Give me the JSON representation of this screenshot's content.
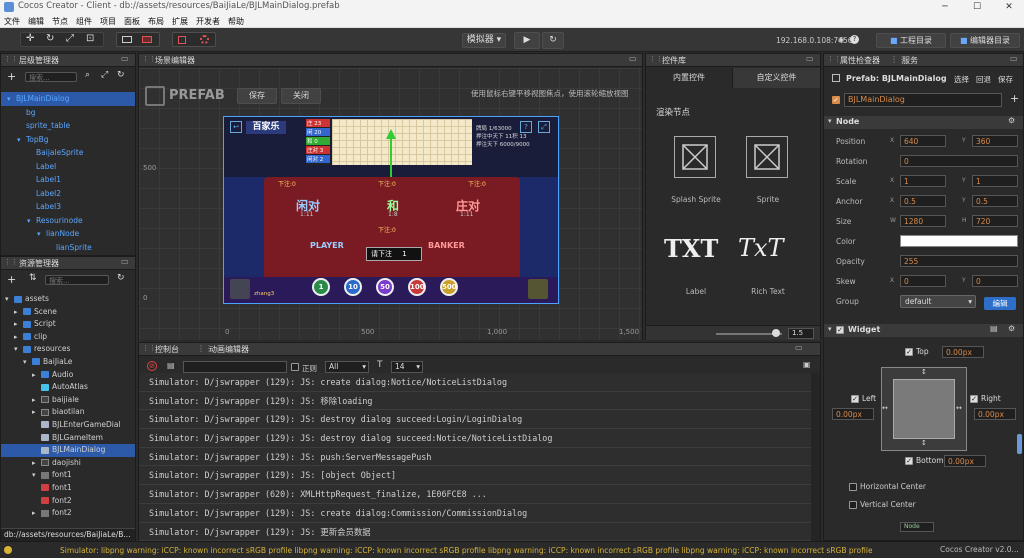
{
  "titlebar": {
    "title": "Cocos Creator - Client - db://assets/resources/BaiJiaLe/BJLMainDialog.prefab",
    "minimize": "─",
    "maximize": "☐",
    "close": "✕"
  },
  "menu": [
    "文件",
    "编辑",
    "节点",
    "组件",
    "项目",
    "面板",
    "布局",
    "扩展",
    "开发者",
    "帮助"
  ],
  "toolbar": {
    "simulator_label": "模拟器 ▾",
    "play_icon": "▶",
    "refresh_icon": "↻",
    "ip_text": "192.168.0.108:7456",
    "wifi_icon": "◉",
    "help_icon": "?",
    "project_btn": "工程目录",
    "editor_btn": "编辑器目录"
  },
  "hierarchy": {
    "title": "层级管理器",
    "search_placeholder": "搜索...",
    "nodes": [
      {
        "label": "BJLMainDialog",
        "color": "blue",
        "indent": 0,
        "arrow": "▾",
        "selected": true
      },
      {
        "label": "bg",
        "color": "blue",
        "indent": 1,
        "arrow": ""
      },
      {
        "label": "sprite_table",
        "color": "blue",
        "indent": 1,
        "arrow": ""
      },
      {
        "label": "TopBg",
        "color": "blue",
        "indent": 1,
        "arrow": "▾"
      },
      {
        "label": "BaijaleSprite",
        "color": "blue",
        "indent": 2,
        "arrow": ""
      },
      {
        "label": "Label",
        "color": "blue",
        "indent": 2,
        "arrow": ""
      },
      {
        "label": "Label1",
        "color": "blue",
        "indent": 2,
        "arrow": ""
      },
      {
        "label": "Label2",
        "color": "blue",
        "indent": 2,
        "arrow": ""
      },
      {
        "label": "Label3",
        "color": "blue",
        "indent": 2,
        "arrow": ""
      },
      {
        "label": "Resourinode",
        "color": "blue",
        "indent": 2,
        "arrow": "▾"
      },
      {
        "label": "lianNode",
        "color": "blue",
        "indent": 3,
        "arrow": "▾"
      },
      {
        "label": "lianSprite",
        "color": "blue",
        "indent": 4,
        "arrow": ""
      }
    ]
  },
  "assets": {
    "title": "资源管理器",
    "search_placeholder": "搜索...",
    "items": [
      {
        "label": "assets",
        "indent": 0,
        "arrow": "▾",
        "icon": "folder"
      },
      {
        "label": "Scene",
        "indent": 1,
        "arrow": "▸",
        "icon": "folder"
      },
      {
        "label": "Script",
        "indent": 1,
        "arrow": "▸",
        "icon": "folder"
      },
      {
        "label": "clip",
        "indent": 1,
        "arrow": "▸",
        "icon": "folder"
      },
      {
        "label": "resources",
        "indent": 1,
        "arrow": "▾",
        "icon": "folder"
      },
      {
        "label": "BaiJiaLe",
        "indent": 2,
        "arrow": "▾",
        "icon": "folder"
      },
      {
        "label": "Audio",
        "indent": 3,
        "arrow": "▸",
        "icon": "folder"
      },
      {
        "label": "AutoAtlas",
        "indent": 3,
        "arrow": "",
        "icon": "atlas"
      },
      {
        "label": "baijiale",
        "indent": 3,
        "arrow": "▸",
        "icon": "file"
      },
      {
        "label": "biaotilan",
        "indent": 3,
        "arrow": "▸",
        "icon": "file"
      },
      {
        "label": "BJLEnterGameDial",
        "indent": 3,
        "arrow": "",
        "icon": "prefab"
      },
      {
        "label": "BJLGameItem",
        "indent": 3,
        "arrow": "",
        "icon": "prefab"
      },
      {
        "label": "BJLMainDialog",
        "indent": 3,
        "arrow": "",
        "icon": "prefab",
        "selected": true
      },
      {
        "label": "daojishi",
        "indent": 3,
        "arrow": "▸",
        "icon": "file"
      },
      {
        "label": "font1",
        "indent": 3,
        "arrow": "▾",
        "icon": "font"
      },
      {
        "label": "font1",
        "indent": 3,
        "arrow": "",
        "icon": "fontred"
      },
      {
        "label": "font2",
        "indent": 3,
        "arrow": "",
        "icon": "fontred"
      },
      {
        "label": "font2",
        "indent": 3,
        "arrow": "▸",
        "icon": "font"
      }
    ],
    "path": "db://assets/resources/BaiJiaLe/B..."
  },
  "scene": {
    "title": "场景编辑器",
    "prefab_label": "PREFAB",
    "save_btn": "保存",
    "close_btn": "关闭",
    "hint": "使用鼠标右键平移视图焦点，使用滚轮缩放视图",
    "y_ticks": [
      "500",
      "0"
    ],
    "x_ticks": [
      "0",
      "500",
      "1,000",
      "1,500"
    ]
  },
  "game": {
    "logo": "百家乐",
    "menu_items": [
      "庄 23",
      "闲 20",
      "和 0",
      "庄对 3",
      "闲对 2"
    ],
    "info_lines": [
      "牌局  1/63000",
      "押注中天下 11积 13",
      "押注天下  6000/9000"
    ],
    "side_values": [
      "0",
      "0",
      "0"
    ],
    "bet_rows": [
      "下注:0",
      "下注:0",
      "下注:0",
      "下注:0"
    ],
    "zones": [
      "闲对",
      "和",
      "庄对"
    ],
    "zone_odds": [
      "1:11",
      "1:8",
      "1:11"
    ],
    "player": "PLAYER",
    "banker": "BANKER",
    "round_label": "请下注",
    "round_value": "1",
    "avatar_name": "zhang3",
    "chips": [
      "1",
      "10",
      "50",
      "100",
      "500"
    ]
  },
  "controls": {
    "title": "控件库",
    "tab_builtin": "内置控件",
    "tab_custom": "自定义控件",
    "section": "渲染节点",
    "items": [
      {
        "label": "Splash Sprite",
        "glyph": "sprite"
      },
      {
        "label": "Sprite",
        "glyph": "sprite"
      },
      {
        "label": "Label",
        "glyph": "TXT"
      },
      {
        "label": "Rich Text",
        "glyph": "TxT"
      }
    ],
    "zoom_value": "1.5"
  },
  "console": {
    "tab1": "控制台",
    "tab2": "动画编辑器",
    "regex_label": "正则",
    "level_value": "All",
    "font_size_value": "14",
    "lines": [
      "Simulator: D/jswrapper (129): JS: create dialog:Notice/NoticeListDialog",
      "Simulator: D/jswrapper (129): JS: 移除loading",
      "Simulator: D/jswrapper (129): JS: destroy dialog succeed:Login/LoginDialog",
      "Simulator: D/jswrapper (129): JS: destroy dialog succeed:Notice/NoticeListDialog",
      "Simulator: D/jswrapper (129): JS: push:ServerMessagePush",
      "Simulator: D/jswrapper (129): JS: [object Object]",
      "Simulator: D/jswrapper (620): XMLHttpRequest_finalize, 1E06FCE8 ...",
      "Simulator: D/jswrapper (129): JS: create dialog:Commission/CommissionDialog",
      "Simulator: D/jswrapper (129): JS: 更新会员数据"
    ]
  },
  "inspector": {
    "tab1": "属性检查器",
    "tab2": "服务",
    "prefab_label": "Prefab: BJLMainDialog",
    "select_btn": "选择",
    "revert_btn": "回退",
    "save_btn": "保存",
    "node_name": "BJLMainDialog",
    "node_section": "Node",
    "props": [
      {
        "label": "Position",
        "x": "640",
        "y": "360"
      },
      {
        "label": "Rotation",
        "single": "0"
      },
      {
        "label": "Scale",
        "x": "1",
        "y": "1"
      },
      {
        "label": "Anchor",
        "x": "0.5",
        "y": "0.5"
      },
      {
        "label": "Size",
        "w": "1280",
        "h": "720"
      },
      {
        "label": "Color",
        "color": "#ffffff"
      },
      {
        "label": "Opacity",
        "single": "255"
      },
      {
        "label": "Skew",
        "x": "0",
        "y": "0"
      },
      {
        "label": "Group",
        "select": "default"
      }
    ],
    "edit_btn": "编辑",
    "widget_section": "Widget",
    "widget": {
      "top": "Top",
      "top_val": "0.00px",
      "left": "Left",
      "left_val": "0.00px",
      "right": "Right",
      "right_val": "0.00px",
      "bottom": "Bottom",
      "bottom_val": "0.00px",
      "hcenter": "Horizontal Center",
      "vcenter": "Vertical Center"
    },
    "node_tag": "Node"
  },
  "status": {
    "warning": "Simulator: libpng warning: iCCP: known incorrect sRGB profile libpng warning: iCCP: known incorrect sRGB profile libpng warning: iCCP: known incorrect sRGB profile libpng warning: iCCP: known incorrect sRGB profile libpng warning: iCCP: known incorrect sRGB profile libpng warning: iCCP",
    "version": "Cocos Creator v2.0..."
  },
  "colors": {
    "accent_blue": "#2d5aa8",
    "tree_blue": "#5aa6ff",
    "orange_value": "#d98b4a",
    "selection_outline": "#4aa3ff"
  }
}
